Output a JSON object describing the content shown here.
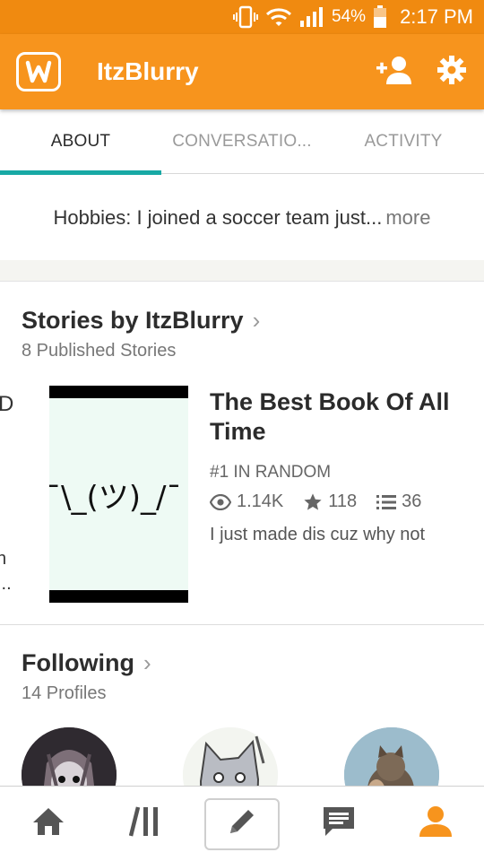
{
  "status_bar": {
    "battery": "54%",
    "time": "2:17 PM"
  },
  "app_bar": {
    "title": "ItzBlurry"
  },
  "tabs": [
    {
      "label": "ABOUT",
      "active": true
    },
    {
      "label": "CONVERSATIO...",
      "active": false
    },
    {
      "label": "ACTIVITY",
      "active": false
    }
  ],
  "about": {
    "text": "Hobbies: I joined a soccer team just...",
    "more_label": "more"
  },
  "stories": {
    "title": "Stories by ItzBlurry",
    "count_label": "8 Published Stories",
    "peek": {
      "top": "D",
      "mid": "n",
      "bottom": "..."
    },
    "featured": {
      "cover_text": "¯\\_(ツ)_/¯",
      "title": "The Best Book Of All Time",
      "rank": "#1 IN RANDOM",
      "reads": "1.14K",
      "votes": "118",
      "parts": "36",
      "description": "I just made dis cuz why not"
    }
  },
  "following": {
    "title": "Following",
    "count_label": "14 Profiles"
  },
  "colors": {
    "brand_orange": "#f7941d",
    "status_orange": "#f08a10",
    "tab_accent": "#17a9a5"
  },
  "icons": {
    "app_actions": [
      "add-person-icon",
      "gear-icon"
    ],
    "bottom_nav": [
      "home-icon",
      "library-icon",
      "pencil-icon",
      "messages-icon",
      "profile-icon"
    ]
  }
}
